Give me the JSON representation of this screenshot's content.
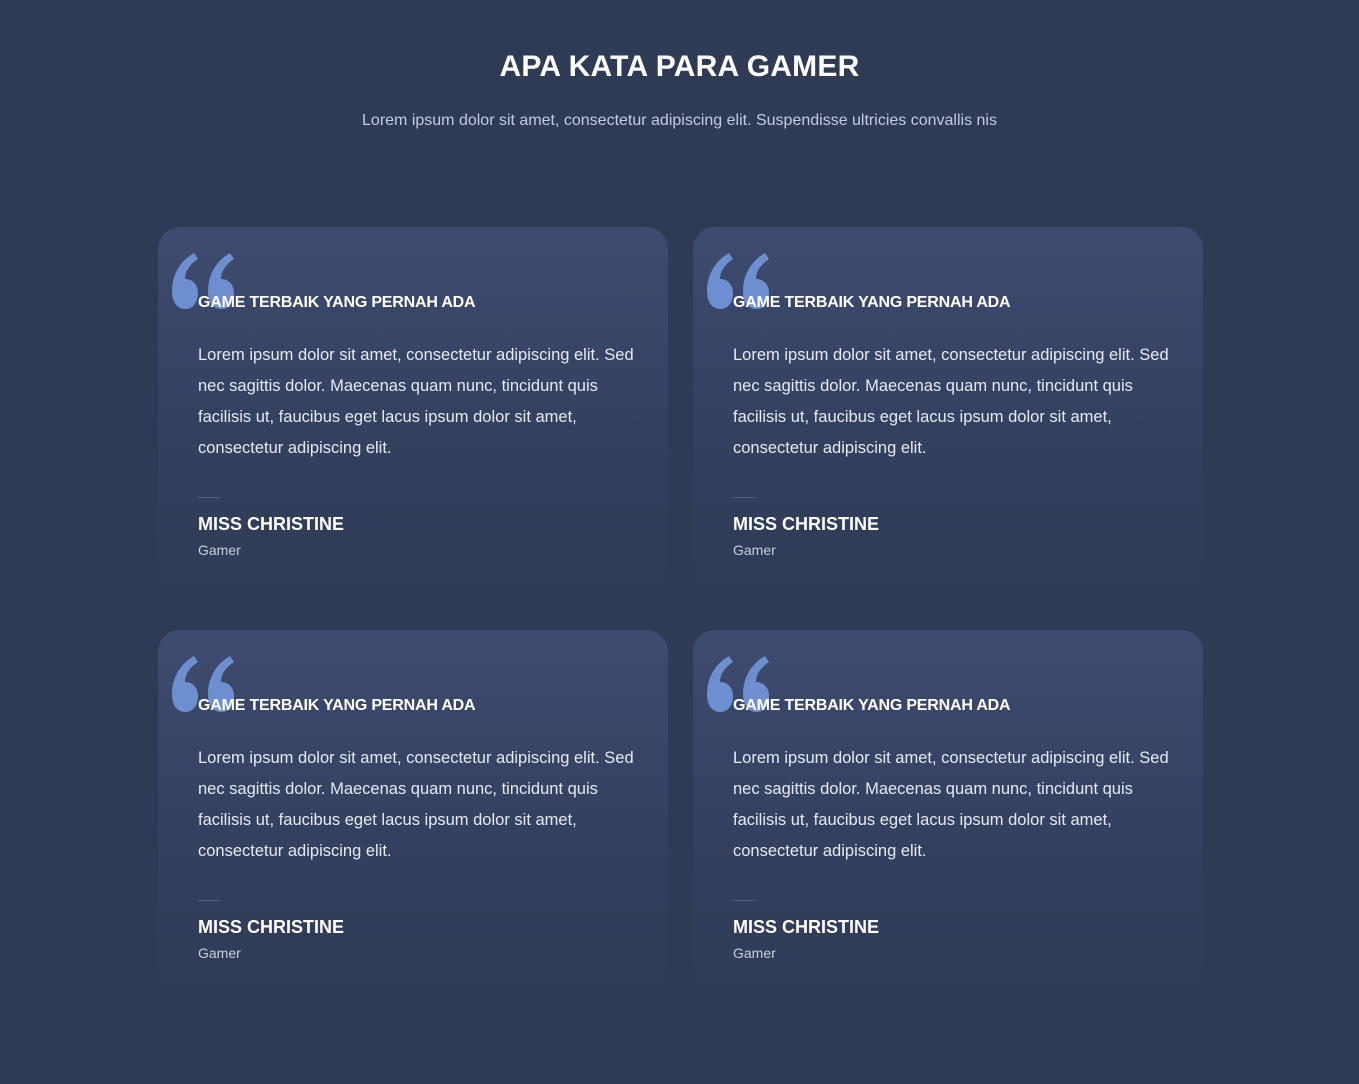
{
  "header": {
    "title": "APA KATA PARA GAMER",
    "subtitle": "Lorem ipsum dolor sit amet, consectetur adipiscing elit. Suspendisse ultricies convallis nis"
  },
  "colors": {
    "background": "#2f3a55",
    "card_top": "#3e4b70",
    "quote_icon": "#6d8fd0"
  },
  "testimonials": [
    {
      "icon": "quote-icon",
      "title": "GAME TERBAIK YANG PERNAH ADA",
      "body": "Lorem ipsum dolor sit amet, consectetur adipiscing elit. Sed nec sagittis dolor. Maecenas quam nunc, tincidunt quis facilisis ut, faucibus eget lacus ipsum dolor sit amet, consectetur adipiscing elit.",
      "author": "MISS CHRISTINE",
      "role": "Gamer"
    },
    {
      "icon": "quote-icon",
      "title": "GAME TERBAIK YANG PERNAH ADA",
      "body": "Lorem ipsum dolor sit amet, consectetur adipiscing elit. Sed nec sagittis dolor. Maecenas quam nunc, tincidunt quis facilisis ut, faucibus eget lacus ipsum dolor sit amet, consectetur adipiscing elit.",
      "author": "MISS CHRISTINE",
      "role": "Gamer"
    },
    {
      "icon": "quote-icon",
      "title": "GAME TERBAIK YANG PERNAH ADA",
      "body": "Lorem ipsum dolor sit amet, consectetur adipiscing elit. Sed nec sagittis dolor. Maecenas quam nunc, tincidunt quis facilisis ut, faucibus eget lacus ipsum dolor sit amet, consectetur adipiscing elit.",
      "author": "MISS CHRISTINE",
      "role": "Gamer"
    },
    {
      "icon": "quote-icon",
      "title": "GAME TERBAIK YANG PERNAH ADA",
      "body": "Lorem ipsum dolor sit amet, consectetur adipiscing elit. Sed nec sagittis dolor. Maecenas quam nunc, tincidunt quis facilisis ut, faucibus eget lacus ipsum dolor sit amet, consectetur adipiscing elit.",
      "author": "MISS CHRISTINE",
      "role": "Gamer"
    }
  ]
}
